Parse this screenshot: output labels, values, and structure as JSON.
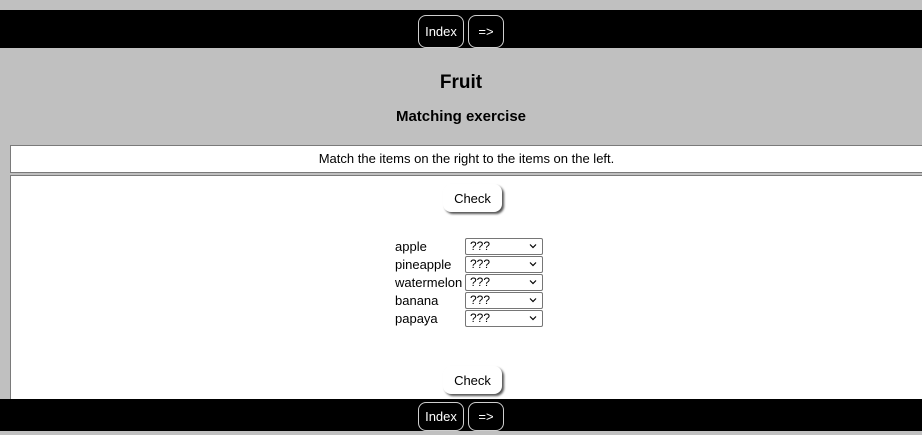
{
  "nav_top": {
    "index_label": "Index",
    "next_label": "=>"
  },
  "header": {
    "title": "Fruit",
    "subtitle": "Matching exercise"
  },
  "instructions": "Match the items on the right to the items on the left.",
  "check_label": "Check",
  "rows": [
    {
      "label": "apple",
      "value": "???"
    },
    {
      "label": "pineapple",
      "value": "???"
    },
    {
      "label": "watermelon",
      "value": "???"
    },
    {
      "label": "banana",
      "value": "???"
    },
    {
      "label": "papaya",
      "value": "???"
    }
  ],
  "nav_bottom": {
    "index_label": "Index",
    "next_label": "=>"
  },
  "colors": {
    "nav_bg": "#000000",
    "header_bg": "#c0c0c0",
    "content_bg": "#ffffff"
  }
}
